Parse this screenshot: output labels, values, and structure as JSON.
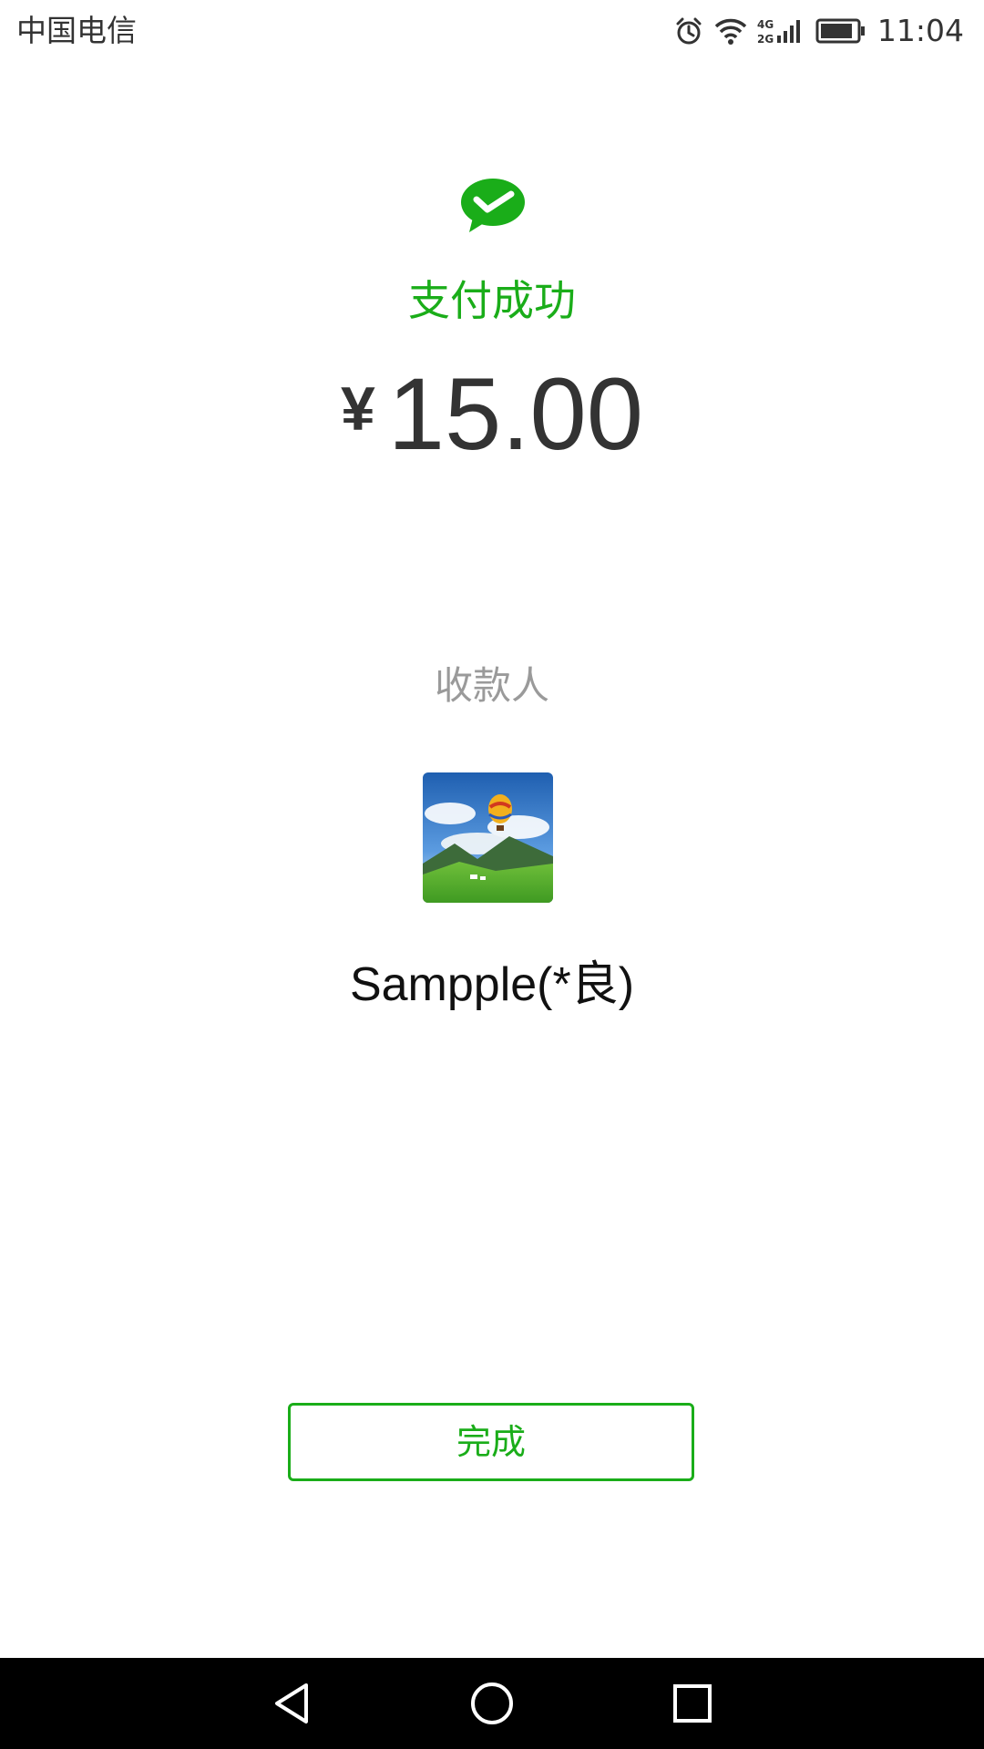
{
  "status_bar": {
    "carrier": "中国电信",
    "network": "4G 2G",
    "time": "11:04"
  },
  "payment": {
    "title": "支付成功",
    "currency": "¥",
    "amount": "15.00",
    "payee_label": "收款人",
    "payee_name": "Sampple(*良)"
  },
  "actions": {
    "done_label": "完成"
  },
  "icons": {
    "logo": "wechat-pay-icon",
    "alarm": "alarm-icon",
    "wifi": "wifi-icon",
    "signal": "signal-icon",
    "battery": "battery-icon",
    "back": "back-icon",
    "home": "home-icon",
    "recents": "recents-icon"
  },
  "colors": {
    "accent": "#1aad19",
    "text_dark": "#333333",
    "text_muted": "#9a9a9a",
    "nav_bar": "#000000"
  }
}
